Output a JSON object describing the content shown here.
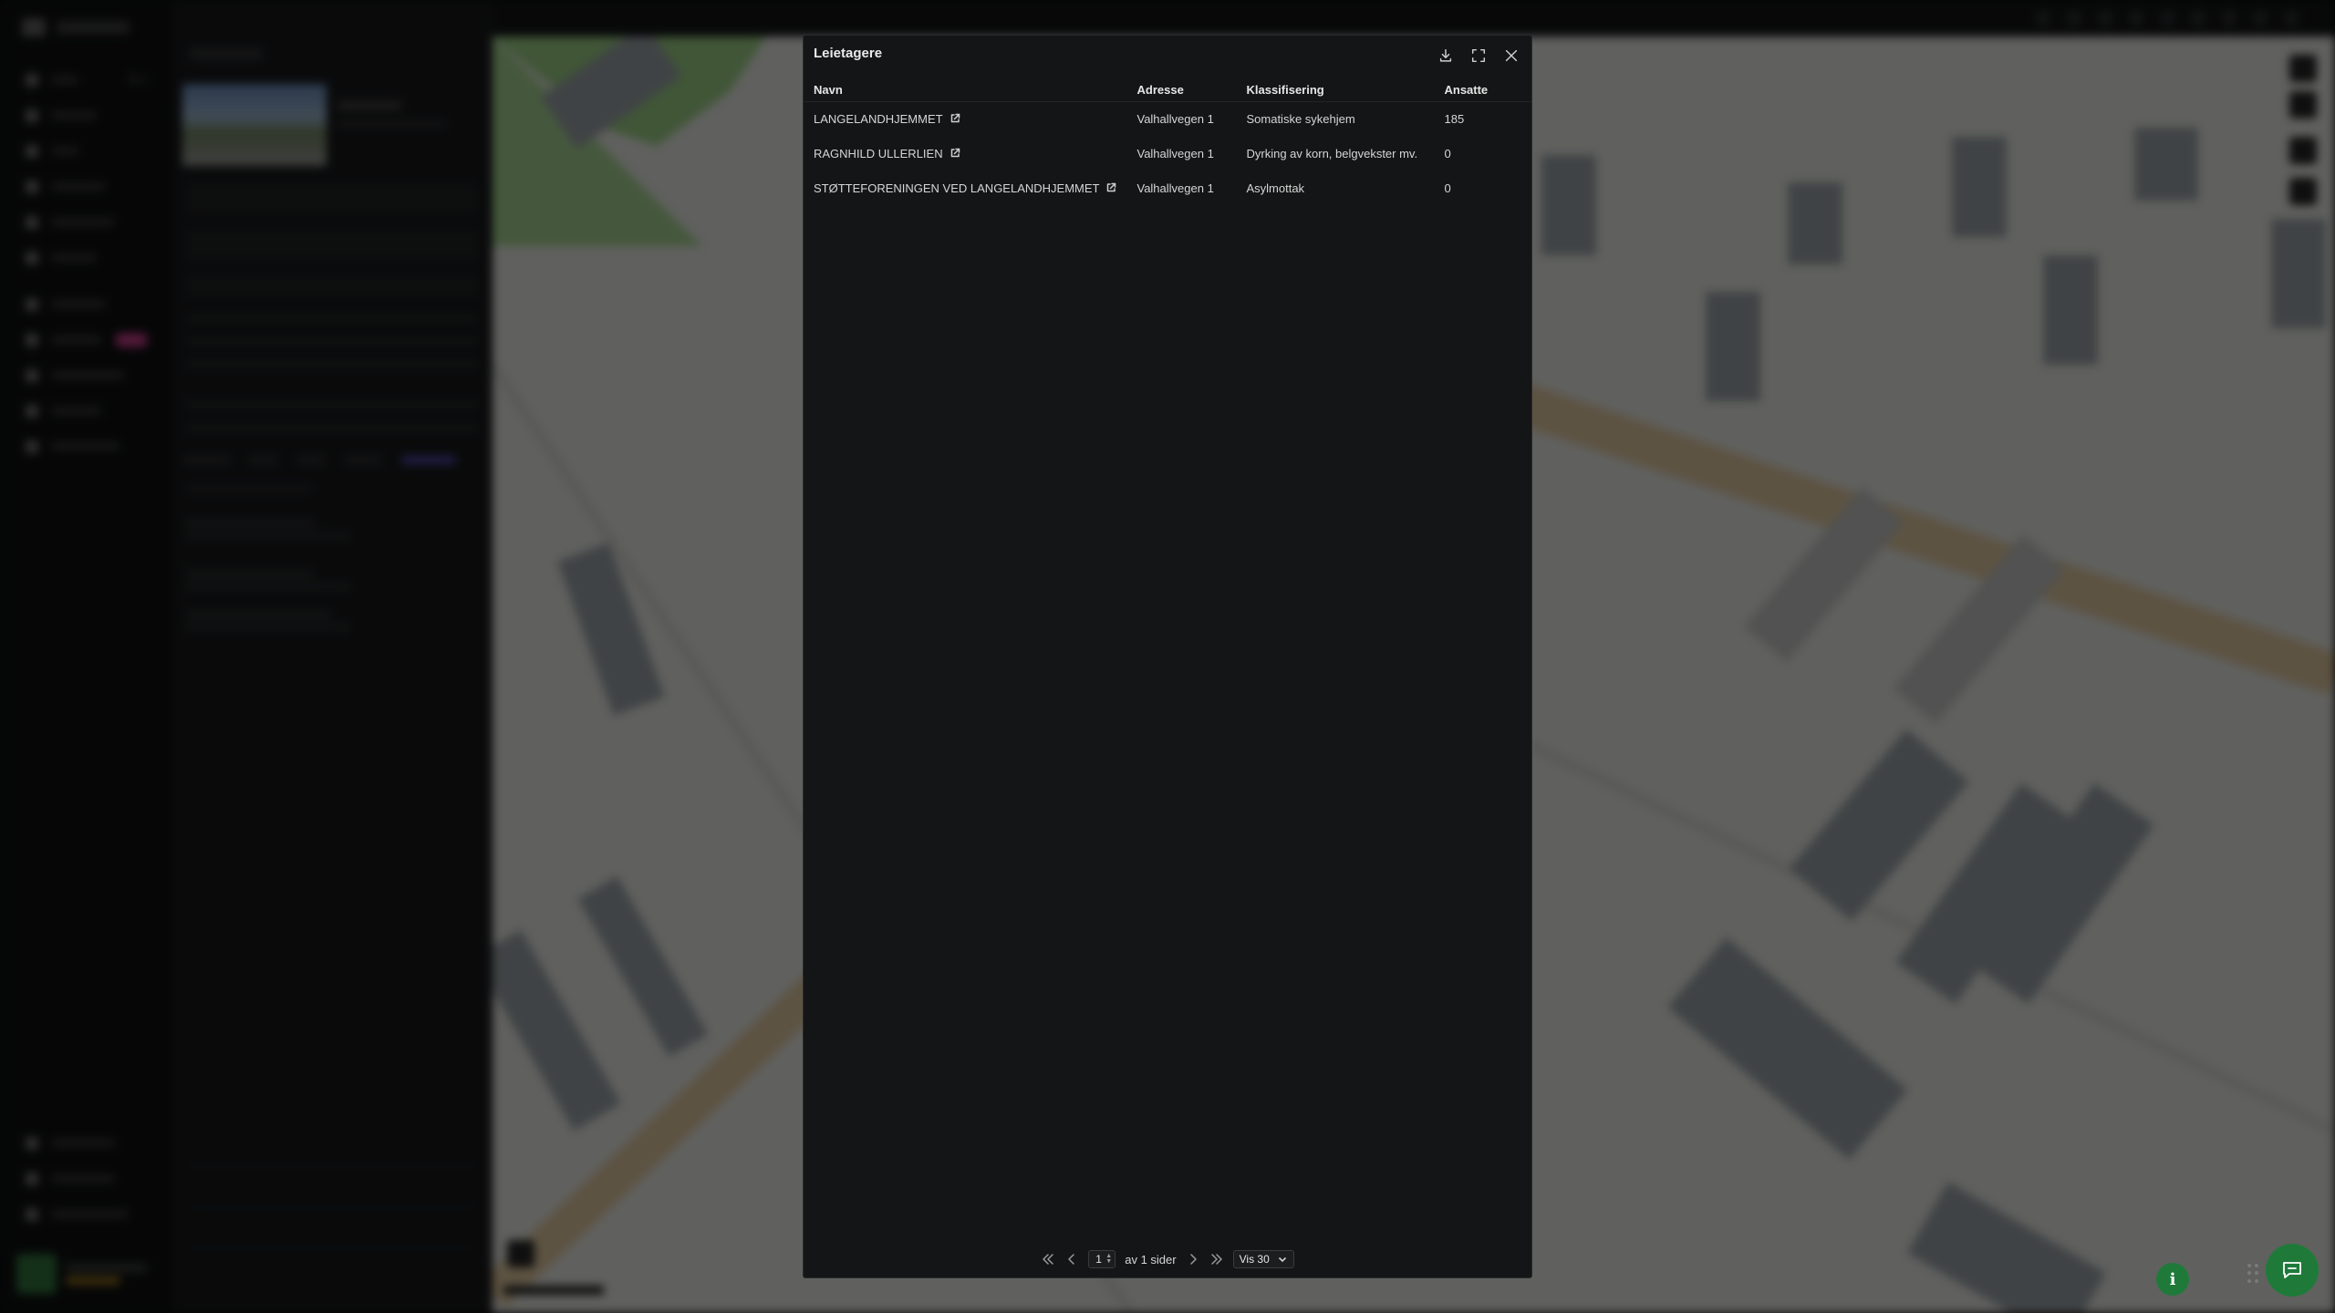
{
  "modal": {
    "title": "Leietagere",
    "columns": [
      "Navn",
      "Adresse",
      "Klassifisering",
      "Ansatte"
    ],
    "rows": [
      {
        "name": "LANGELANDHJEMMET",
        "address": "Valhallvegen 1",
        "classification": "Somatiske sykehjem",
        "employees": "185"
      },
      {
        "name": "RAGNHILD ULLERLIEN",
        "address": "Valhallvegen 1",
        "classification": "Dyrking av korn, belgvekster mv.",
        "employees": "0"
      },
      {
        "name": "STØTTEFORENINGEN VED LANGELANDHJEMMET",
        "address": "Valhallvegen 1",
        "classification": "Asylmottak",
        "employees": "0"
      }
    ],
    "pagination": {
      "current_page": "1",
      "of_pages_label": "av 1 sider",
      "per_page_label": "Vis 30"
    }
  },
  "icons": {
    "download": "download-icon",
    "expand": "expand-icon",
    "close": "close-icon",
    "external_link": "external-link-icon",
    "first_page": "double-chevron-left-icon",
    "prev_page": "chevron-left-icon",
    "next_page": "chevron-right-icon",
    "last_page": "double-chevron-right-icon",
    "info": "info-icon",
    "chat": "chat-icon"
  },
  "colors": {
    "modal_bg": "#141516",
    "accent_green": "#1f7a3a",
    "nav_badge": "#b5397f",
    "map_water": "#5fa6ad",
    "map_park": "#6fb56a",
    "map_road": "#d8a85b"
  }
}
